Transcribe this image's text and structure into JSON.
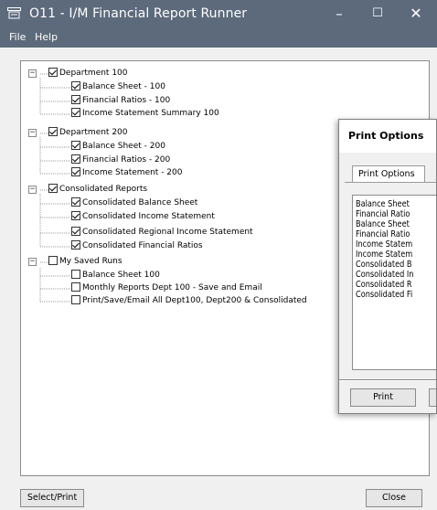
{
  "window": {
    "title": "O11 - I/M Financial Report Runner",
    "controls": {
      "minimize": "–",
      "maximize": "☐",
      "close": "✕"
    },
    "app_icon": "window-app-icon",
    "colors": {
      "titlebar": "#5c6a7c",
      "panel": "#ffffff",
      "background": "#f0f0f0"
    }
  },
  "menu": {
    "file": "File",
    "help": "Help"
  },
  "tree": {
    "groups": [
      {
        "label": "Department 100",
        "checked": true,
        "items": [
          {
            "label": "Balance Sheet - 100",
            "checked": true
          },
          {
            "label": "Financial Ratios - 100",
            "checked": true
          },
          {
            "label": "Income Statement Summary 100",
            "checked": true
          }
        ]
      },
      {
        "label": "Department 200",
        "checked": true,
        "items": [
          {
            "label": "Balance Sheet - 200",
            "checked": true
          },
          {
            "label": "Financial Ratios - 200",
            "checked": true
          },
          {
            "label": "Income Statement - 200",
            "checked": true
          }
        ]
      },
      {
        "label": "Consolidated Reports",
        "checked": true,
        "items": [
          {
            "label": "Consolidated Balance Sheet",
            "checked": true
          },
          {
            "label": "Consolidated Income Statement",
            "checked": true
          },
          {
            "label": "Consolidated Regional Income Statement",
            "checked": true
          },
          {
            "label": "Consolidated Financial Ratios",
            "checked": true
          }
        ]
      },
      {
        "label": "My Saved Runs",
        "checked": false,
        "items": [
          {
            "label": "Balance Sheet 100",
            "checked": false
          },
          {
            "label": "Monthly Reports Dept 100 - Save and Email",
            "checked": false
          },
          {
            "label": "Print/Save/Email All Dept100, Dept200 & Consolidated",
            "checked": false
          }
        ]
      }
    ],
    "expander_symbol": "−"
  },
  "buttons": {
    "select_print": "Select/Print",
    "close": "Close"
  },
  "print_dialog": {
    "title": "Print Options",
    "tab_label": "Print Options",
    "list_items": [
      "Balance Sheet",
      "Financial Ratio",
      "Balance Sheet",
      "Financial Ratio",
      "Income Statem",
      "Income Statem",
      "Consolidated B",
      "Consolidated In",
      "Consolidated R",
      "Consolidated Fi"
    ],
    "print_button": "Print"
  }
}
